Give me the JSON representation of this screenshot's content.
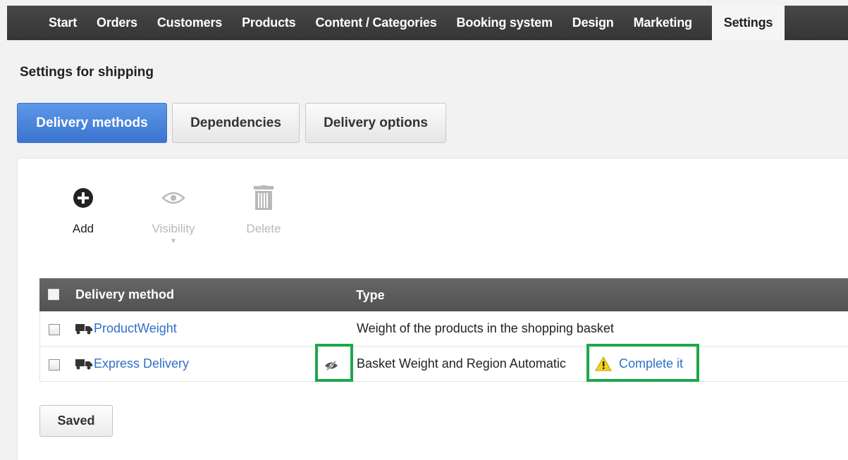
{
  "nav": {
    "items": [
      {
        "label": "Start"
      },
      {
        "label": "Orders"
      },
      {
        "label": "Customers"
      },
      {
        "label": "Products"
      },
      {
        "label": "Content / Categories"
      },
      {
        "label": "Booking system"
      },
      {
        "label": "Design"
      },
      {
        "label": "Marketing"
      }
    ],
    "active": "Settings"
  },
  "page": {
    "title": "Settings for shipping"
  },
  "tabs": [
    {
      "label": "Delivery methods",
      "active": true
    },
    {
      "label": "Dependencies",
      "active": false
    },
    {
      "label": "Delivery options",
      "active": false
    }
  ],
  "toolbar": {
    "add_label": "Add",
    "add_icon": "plus-circle-icon",
    "visibility_label": "Visibility",
    "visibility_icon": "eye-icon",
    "delete_label": "Delete",
    "delete_icon": "trash-icon"
  },
  "table": {
    "columns": [
      "Delivery method",
      "Type"
    ],
    "rows": [
      {
        "name": "ProductWeight",
        "type": "Weight of the products in the shopping basket",
        "icon": "truck-icon"
      },
      {
        "name": "Express Delivery",
        "type": "Basket Weight and Region Automatic",
        "icon": "truck-icon",
        "hidden_icon": "eye-slash-icon",
        "warning_icon": "warning-icon",
        "action": "Complete it"
      }
    ]
  },
  "footer": {
    "saved_label": "Saved"
  },
  "colors": {
    "highlight": "#1ea84a",
    "link": "#2e70c9",
    "active_tab": "#3a74cf",
    "nav_bg": "#3d3d3d"
  }
}
